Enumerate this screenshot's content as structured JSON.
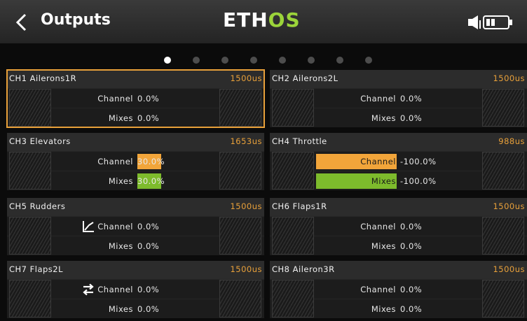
{
  "header": {
    "title": "Outputs",
    "logo_part1": "ETH",
    "logo_part2": "OS",
    "icons": [
      "back-chevron-icon",
      "speaker-icon",
      "battery-icon"
    ]
  },
  "pager": {
    "count": 8,
    "active_index": 0
  },
  "labels": {
    "channel": "Channel",
    "mixes": "Mixes"
  },
  "channels": [
    {
      "name": "CH1  Ailerons1R",
      "output": "1500us",
      "channel": "0.0%",
      "mixes": "0.0%",
      "selected": true
    },
    {
      "name": "CH2  Ailerons2L",
      "output": "1500us",
      "channel": "0.0%",
      "mixes": "0.0%"
    },
    {
      "name": "CH3  Elevators",
      "output": "1653us",
      "channel": "30.0%",
      "mixes": "30.0%"
    },
    {
      "name": "CH4  Throttle",
      "output": "988us",
      "channel": "-100.0%",
      "mixes": "-100.0%"
    },
    {
      "name": "CH5  Rudders",
      "output": "1500us",
      "channel": "0.0%",
      "mixes": "0.0%",
      "icon": "curve-icon"
    },
    {
      "name": "CH6  Flaps1R",
      "output": "1500us",
      "channel": "0.0%",
      "mixes": "0.0%"
    },
    {
      "name": "CH7  Flaps2L",
      "output": "1500us",
      "channel": "0.0%",
      "mixes": "0.0%",
      "icon": "reverse-arrows-icon"
    },
    {
      "name": "CH8  Aileron3R",
      "output": "1500us",
      "channel": "0.0%",
      "mixes": "0.0%"
    }
  ],
  "colors": {
    "accent": "#e8a03a",
    "channel_bar": "#f2a53a",
    "mixes_bar": "#7dbb2c",
    "logo_os": "#9bd43a"
  }
}
